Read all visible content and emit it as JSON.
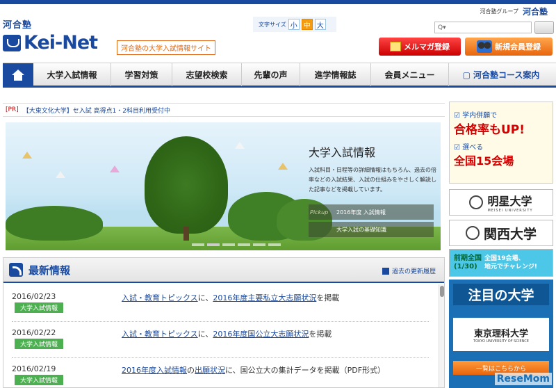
{
  "header": {
    "group_text": "河合塾グループ",
    "group_logo": "河合塾",
    "logo_small": "河合塾",
    "logo_main": "Kei-Net",
    "tagline": "河合塾の大学入試情報サイト",
    "fontsize_label": "文字サイズ",
    "fontsize_small": "小",
    "fontsize_medium": "中",
    "fontsize_large": "大",
    "search_placeholder": "Q▾",
    "mail_button": "メルマガ登録",
    "register_button": "新規会員登録"
  },
  "nav": {
    "items": [
      "大学入試情報",
      "学習対策",
      "志望校検索",
      "先輩の声",
      "進学情報誌",
      "会員メニュー",
      "河合塾コース案内"
    ]
  },
  "pr": {
    "tag": "[PR]",
    "text": "【大東文化大学】セ入試 高得点1・2科目利用受付中"
  },
  "hero": {
    "title": "大学入試情報",
    "desc": "入試科目・日程等の詳細情報はもちろん、過去の倍率などの入試結果、入試の仕組みをやさしく解説した記事などを掲載しています。",
    "pickup_label": "Pickup",
    "pickup": [
      "2016年度 入試情報",
      "大学入試の基礎知識"
    ]
  },
  "news": {
    "title": "最新情報",
    "more": "過去の更新履歴",
    "rows": [
      {
        "date": "2016/02/23",
        "badge": "大学入試情報",
        "link1": "入試・教育トピックス",
        "t1": "に、",
        "link2": "2016年度主要私立大志願状況",
        "t2": "を掲載"
      },
      {
        "date": "2016/02/22",
        "badge": "大学入試情報",
        "link1": "入試・教育トピックス",
        "t1": "に、",
        "link2": "2016年度国公立大志願状況",
        "t2": "を掲載"
      },
      {
        "date": "2016/02/19",
        "badge": "大学入試情報",
        "link1": "2016年度入試情報",
        "t1": "の",
        "link2": "出願状況",
        "t2": "に、国公立大の集計データを掲載（PDF形式）"
      }
    ]
  },
  "sidebar": {
    "ad1_l1": "学内併願で",
    "ad1_l2": "合格率もUP!",
    "ad1_l3": "選べる",
    "ad1_l4": "全国15会場",
    "uni1_name": "明星大学",
    "uni1_sub": "MEISEI UNIVERSITY",
    "uni2_name": "関西大学",
    "ad4_a1": "前期全国",
    "ad4_a2": "(1/30)",
    "ad4_b1": "全国19会場、",
    "ad4_b2": "地元でチャレンジ!",
    "ad5_title": "注目の大学",
    "tus_name": "東京理科大学",
    "tus_sub": "TOKYO UNIVERSITY OF SCIENCE",
    "ad5_btn": "一覧はこちらから"
  },
  "watermark": "ReseMom"
}
